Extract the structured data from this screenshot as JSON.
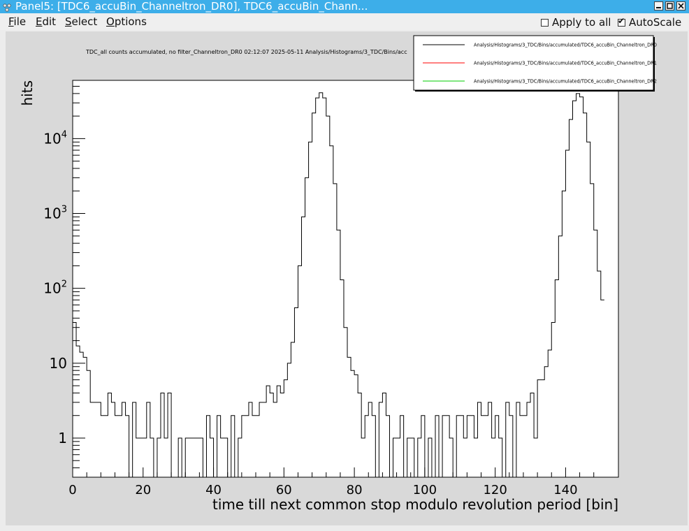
{
  "window": {
    "title": "Panel5: [TDC6_accuBin_Channeltron_DR0], TDC6_accuBin_Chann..."
  },
  "menu": [
    "File",
    "Edit",
    "Select",
    "Options"
  ],
  "options": {
    "apply_to_all": {
      "label": "Apply to all",
      "checked": false
    },
    "autoscale": {
      "label": "AutoScale",
      "checked": true
    }
  },
  "colors": {
    "titlebar": "#3daee9",
    "canvas_bg": "#d9d9d9",
    "frame_bg": "#ffffff"
  },
  "chart_data": {
    "type": "line",
    "title": "TDC_all counts accumulated, no filter_Channeltron_DR0  02:12:07  2025-05-11  Analysis/Histograms/3_TDC/Bins/acc",
    "xlabel": "time till next common stop modulo revolution period [bin]",
    "ylabel": "hits",
    "xlim": [
      0,
      155
    ],
    "ylim": [
      0.3,
      60000
    ],
    "log_y": true,
    "x_ticks": [
      "0",
      "20",
      "40",
      "60",
      "80",
      "100",
      "120",
      "140"
    ],
    "y_ticks": [
      {
        "value": 1,
        "base": "1",
        "exp": ""
      },
      {
        "value": 10,
        "base": "10",
        "exp": ""
      },
      {
        "value": 100,
        "base": "10",
        "exp": "2"
      },
      {
        "value": 1000,
        "base": "10",
        "exp": "3"
      },
      {
        "value": 10000,
        "base": "10",
        "exp": "4"
      }
    ],
    "legend": {
      "position": "top-right",
      "entries": [
        {
          "name": "Analysis/Histograms/3_TDC/Bins/accumulated/TDC6_accuBin_Channeltron_DR0",
          "color": "#000000"
        },
        {
          "name": "Analysis/Histograms/3_TDC/Bins/accumulated/TDC6_accuBin_Channeltron_DR1",
          "color": "#ff0000"
        },
        {
          "name": "Analysis/Histograms/3_TDC/Bins/accumulated/TDC6_accuBin_Channeltron_DR2",
          "color": "#00cc00"
        }
      ]
    },
    "series": [
      {
        "name": "Analysis/Histograms/3_TDC/Bins/accumulated/TDC6_accuBin_Channeltron_DR0",
        "color": "#000000",
        "values": [
          35,
          17,
          14,
          12,
          8,
          3,
          3,
          3,
          2,
          2,
          4,
          3,
          2,
          2,
          3,
          2,
          0,
          3,
          1,
          1,
          1,
          3,
          1,
          0,
          1,
          4,
          1,
          4,
          0,
          0,
          1,
          0,
          1,
          1,
          1,
          1,
          1,
          0,
          2,
          1,
          0,
          2,
          1,
          1,
          0,
          2,
          0,
          1,
          2,
          2,
          3,
          2,
          2,
          3,
          3,
          5,
          4,
          3,
          5,
          4,
          6,
          10,
          19,
          55,
          200,
          900,
          3000,
          9000,
          22000,
          35000,
          41000,
          35000,
          20000,
          8000,
          2500,
          600,
          130,
          30,
          12,
          8,
          7,
          4,
          1,
          2,
          3,
          2,
          0,
          3,
          4,
          2,
          0,
          1,
          1,
          2,
          0,
          1,
          1,
          0,
          1,
          2,
          0,
          1,
          0,
          2,
          0,
          2,
          2,
          1,
          0,
          2,
          2,
          1,
          2,
          2,
          1,
          3,
          2,
          2,
          3,
          1,
          2,
          1,
          0,
          3,
          2,
          0,
          3,
          2,
          2,
          3,
          4,
          1,
          6,
          6,
          9,
          15,
          35,
          130,
          500,
          2000,
          7000,
          18000,
          32000,
          40000,
          36000,
          22000,
          9000,
          2500,
          600,
          170,
          70
        ]
      }
    ]
  }
}
